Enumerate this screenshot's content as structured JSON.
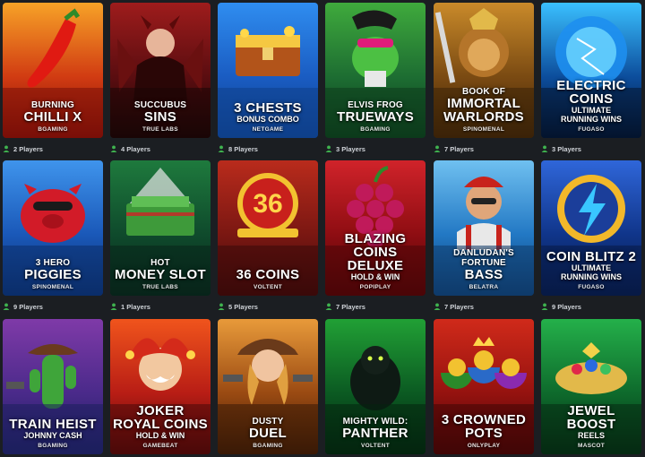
{
  "player_icon": "user-icon",
  "games": [
    {
      "lines": [
        "BURNING",
        "CHILLI X"
      ],
      "styles": [
        "t-small",
        "t-big"
      ],
      "provider": "BGAMING",
      "players": "2 Players",
      "colors": [
        "#7a0f08",
        "#d13b12",
        "#f7a227"
      ],
      "art": "chili"
    },
    {
      "lines": [
        "SUCCUBUS",
        "SINS"
      ],
      "styles": [
        "t-small",
        "t-big"
      ],
      "provider": "TRUE LABS",
      "players": "4 Players",
      "colors": [
        "#1a0606",
        "#5a0d10",
        "#9e1c1c"
      ],
      "art": "devil"
    },
    {
      "lines": [
        "3 CHESTS",
        "BONUS COMBO"
      ],
      "styles": [
        "t-big",
        "t-sub"
      ],
      "provider": "NETGAME",
      "players": "8 Players",
      "colors": [
        "#0e3f8a",
        "#1a5cc2",
        "#2f8df0"
      ],
      "art": "chest"
    },
    {
      "lines": [
        "ELVIS FROG",
        "TRUEWAYS"
      ],
      "styles": [
        "t-small",
        "t-big"
      ],
      "provider": "BGAMING",
      "players": "3 Players",
      "colors": [
        "#0c3a1b",
        "#1d6d32",
        "#3faa3c"
      ],
      "art": "frog"
    },
    {
      "lines": [
        "BOOK OF",
        "IMMORTAL",
        "WARLORDS"
      ],
      "styles": [
        "t-small",
        "t-big",
        "t-big"
      ],
      "provider": "SPINOMENAL",
      "players": "7 Players",
      "colors": [
        "#3b2208",
        "#7a4a12",
        "#c98a2a"
      ],
      "art": "lion"
    },
    {
      "lines": [
        "ELECTRIC",
        "COINS",
        "ULTIMATE",
        "RUNNING WINS"
      ],
      "styles": [
        "t-big",
        "t-big",
        "t-sub",
        "t-sub"
      ],
      "provider": "FUGASO",
      "players": "3 Players",
      "colors": [
        "#04142e",
        "#0c4d9c",
        "#3ac0ff"
      ],
      "art": "orb"
    },
    {
      "lines": [
        "3 HERO",
        "PIGGIES"
      ],
      "styles": [
        "t-small",
        "t-big"
      ],
      "provider": "SPINOMENAL",
      "players": "9 Players",
      "colors": [
        "#0b2d6a",
        "#1a58b8",
        "#3f94ec"
      ],
      "art": "pig"
    },
    {
      "lines": [
        "HOT",
        "MONEY SLOT"
      ],
      "styles": [
        "t-small",
        "t-big"
      ],
      "provider": "TRUE LABS",
      "players": "1 Players",
      "colors": [
        "#08241a",
        "#0f4a2c",
        "#1e7a3d"
      ],
      "art": "money"
    },
    {
      "lines": [
        "36 COINS"
      ],
      "styles": [
        "t-big"
      ],
      "provider": "VOLTENT",
      "players": "5 Players",
      "colors": [
        "#3a0a0a",
        "#7a1712",
        "#b92b1c"
      ],
      "art": "coins36"
    },
    {
      "lines": [
        "BLAZING",
        "COINS",
        "DELUXE",
        "HOLD & WIN"
      ],
      "styles": [
        "t-big",
        "t-big",
        "t-big",
        "t-sub"
      ],
      "provider": "POPIPLAY",
      "players": "7 Players",
      "colors": [
        "#4a0507",
        "#8e0d12",
        "#d0232a"
      ],
      "art": "grapes"
    },
    {
      "lines": [
        "DANLUDAN'S",
        "FORTUNE",
        "BASS"
      ],
      "styles": [
        "t-small",
        "t-small",
        "t-big"
      ],
      "provider": "BELATRA",
      "players": "7 Players",
      "colors": [
        "#0e3a6a",
        "#2278c4",
        "#6fc0f0"
      ],
      "art": "man"
    },
    {
      "lines": [
        "COIN BLITZ 2",
        "ULTIMATE",
        "RUNNING WINS"
      ],
      "styles": [
        "t-big",
        "t-sub",
        "t-sub"
      ],
      "provider": "FUGASO",
      "players": "9 Players",
      "colors": [
        "#071a45",
        "#10358a",
        "#2f66d9"
      ],
      "art": "bolt"
    },
    {
      "lines": [
        "TRAIN HEIST",
        "JOHNNY CASH"
      ],
      "styles": [
        "t-big",
        "t-sub"
      ],
      "provider": "BGAMING",
      "players": "",
      "colors": [
        "#1b1f5c",
        "#4a2a8a",
        "#7f3aa8"
      ],
      "art": "cactus"
    },
    {
      "lines": [
        "JOKER",
        "ROYAL COINS",
        "HOLD & WIN"
      ],
      "styles": [
        "t-big",
        "t-big",
        "t-sub"
      ],
      "provider": "GAMEBEAT",
      "players": "",
      "colors": [
        "#4a0909",
        "#b81d15",
        "#f0541c"
      ],
      "art": "joker"
    },
    {
      "lines": [
        "DUSTY",
        "DUEL"
      ],
      "styles": [
        "t-small",
        "t-big"
      ],
      "provider": "BGAMING",
      "players": "",
      "colors": [
        "#3a1a06",
        "#9a4a12",
        "#e89a3a"
      ],
      "art": "cowgirl"
    },
    {
      "lines": [
        "MIGHTY WILD:",
        "PANTHER"
      ],
      "styles": [
        "t-small",
        "t-big"
      ],
      "provider": "VOLTENT",
      "players": "",
      "colors": [
        "#04240f",
        "#0b5a22",
        "#21a035"
      ],
      "art": "panther"
    },
    {
      "lines": [
        "3 CROWNED",
        "POTS"
      ],
      "styles": [
        "t-big",
        "t-big"
      ],
      "provider": "ONLYPLAY",
      "players": "",
      "colors": [
        "#400606",
        "#95120f",
        "#d02a1a"
      ],
      "art": "pots"
    },
    {
      "lines": [
        "JEWEL",
        "BOOST",
        "REELS"
      ],
      "styles": [
        "t-big",
        "t-big",
        "t-sub"
      ],
      "provider": "MASCOT",
      "players": "",
      "colors": [
        "#052a12",
        "#0e6a2c",
        "#24b04a"
      ],
      "art": "jewel"
    }
  ]
}
